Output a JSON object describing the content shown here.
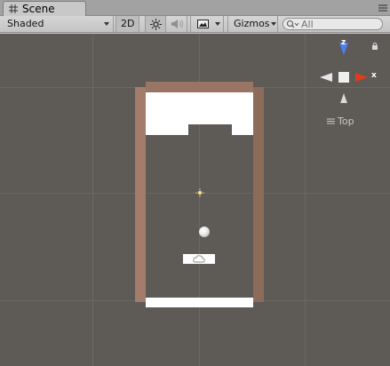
{
  "window": {
    "tab_label": "Scene",
    "tab_icon": "grid-icon",
    "menu_icon": "context-menu-icon"
  },
  "toolbar": {
    "shading_mode": "Shaded",
    "mode_2d_label": "2D",
    "lighting_icon": "sun-icon",
    "audio_icon": "speaker-icon",
    "effects_icon": "image-icon",
    "gizmos_label": "Gizmos",
    "search_placeholder": "All"
  },
  "scene_view": {
    "background_color": "#5e5a55",
    "orientation_gizmo": {
      "axis_labels": {
        "z": "z",
        "x": "x"
      },
      "view_label": "Top",
      "axis_colors": {
        "z": "#4d7ef5",
        "x": "#e23a1c",
        "neutral": "#e6e6e6"
      }
    },
    "objects": [
      "wall-left",
      "wall-right",
      "wall-top",
      "brick-block",
      "bottom-bar",
      "paddle",
      "ball",
      "light"
    ]
  }
}
